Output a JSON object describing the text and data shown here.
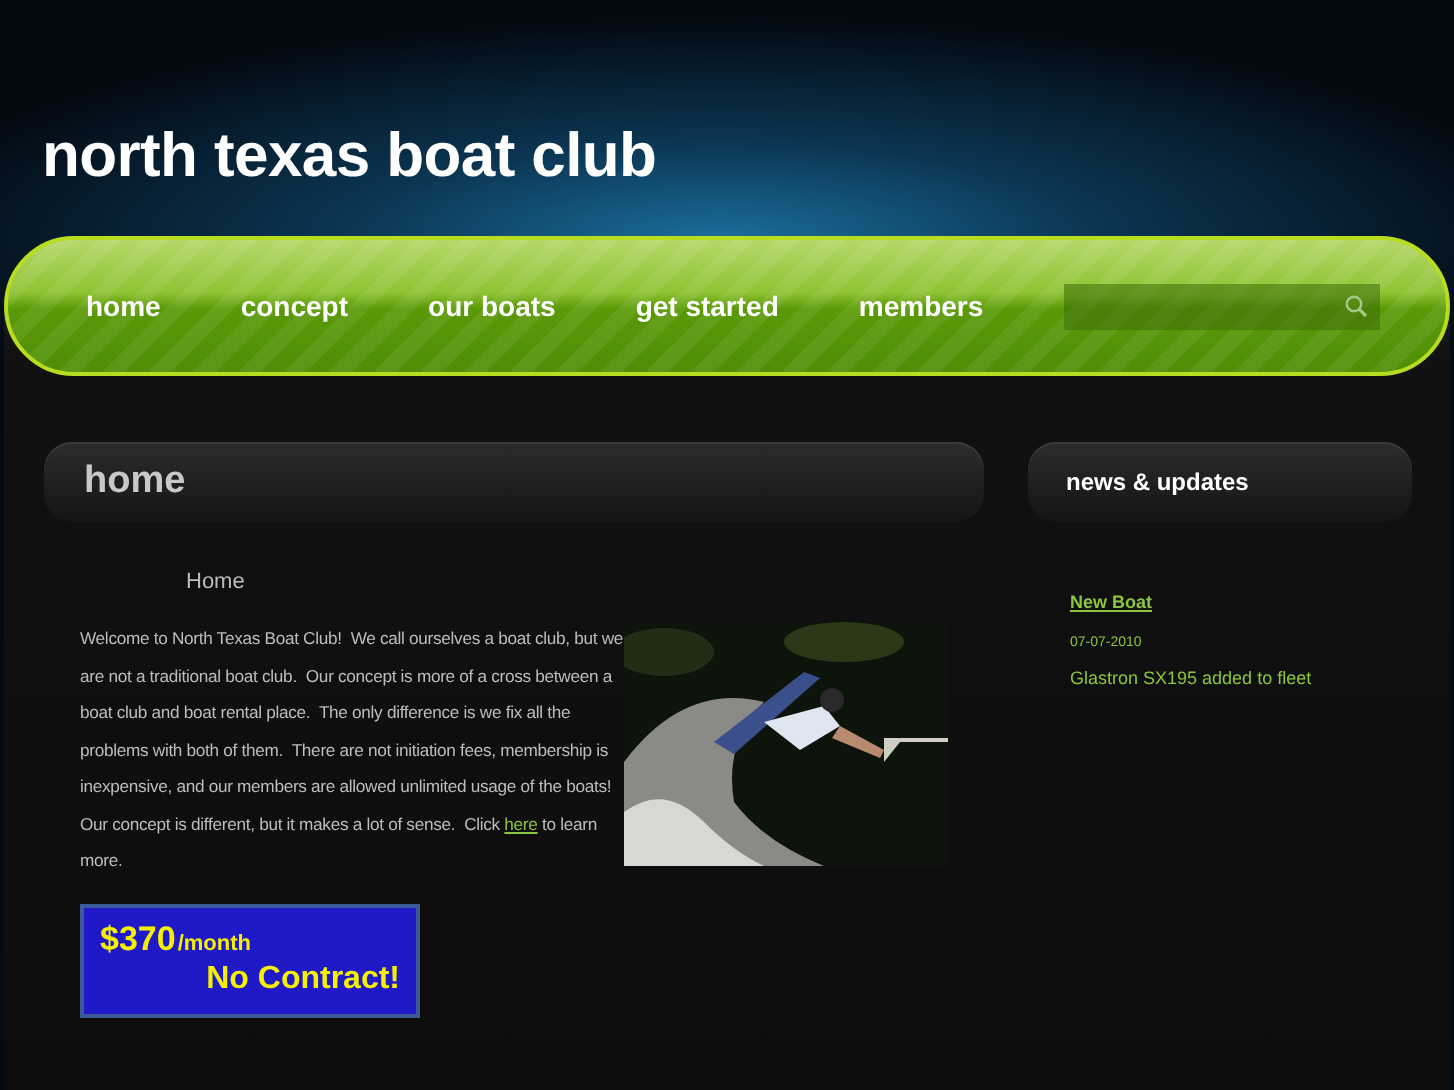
{
  "site_title": "north texas boat club",
  "nav": {
    "items": [
      {
        "label": "home"
      },
      {
        "label": "concept"
      },
      {
        "label": "our boats"
      },
      {
        "label": "get started"
      },
      {
        "label": "members"
      }
    ]
  },
  "main": {
    "heading": "home",
    "subheading": "Home",
    "paragraph": {
      "text_before": "Welcome to North Texas Boat Club!  We call ourselves a boat club, but we are not a traditional boat club.  Our concept is more of a cross between a boat club and boat rental place.  The only difference is we fix all the problems with both of them.  There are not initiation fees, membership is inexpensive, and our members are allowed unlimited usage of the boats!  Our concept is different, but it makes a lot of sense.  Click ",
      "link": "here",
      "text_after": " to learn more."
    },
    "banner": {
      "price": "$370",
      "period": "/month",
      "tagline": "No Contract!"
    }
  },
  "sidebar": {
    "heading": "news & updates",
    "news": [
      {
        "title": "New Boat",
        "date": "07-07-2010",
        "text": "Glastron SX195 added to fleet"
      }
    ]
  }
}
